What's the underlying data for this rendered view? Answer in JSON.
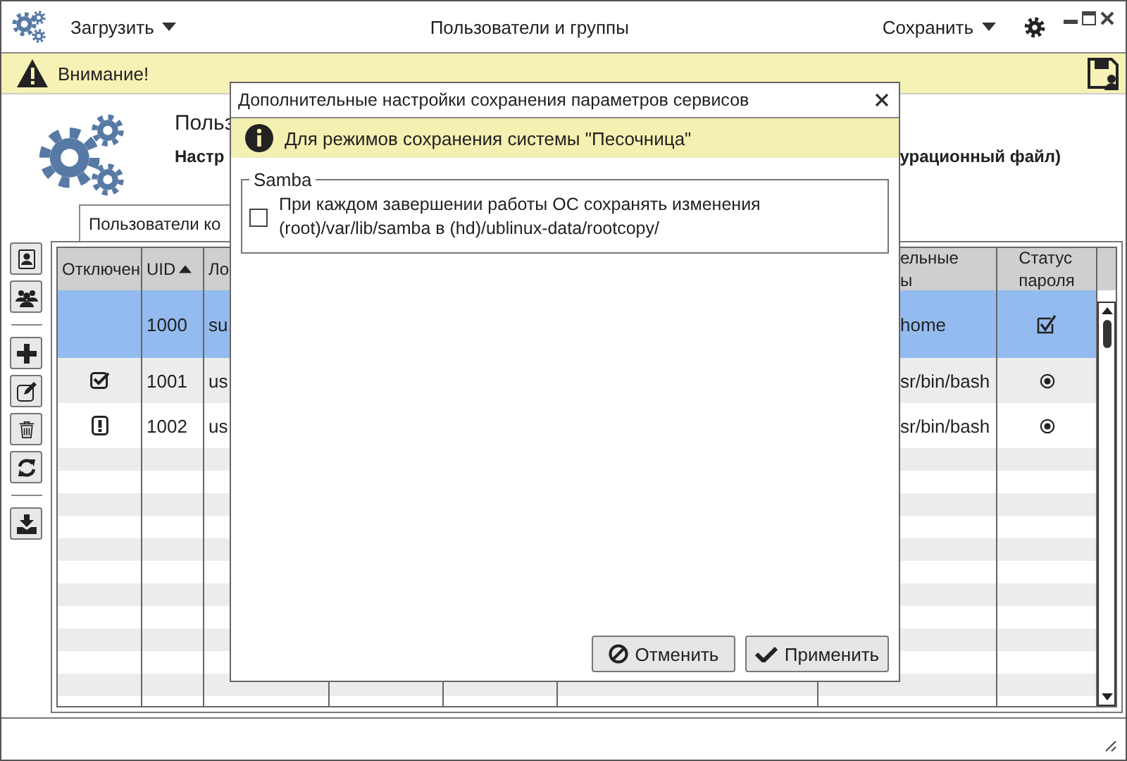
{
  "app": {
    "title": "Пользователи и группы",
    "load_menu": "Загрузить",
    "save_menu": "Сохранить"
  },
  "warning": {
    "text": "Внимание!"
  },
  "header": {
    "title": "Польз",
    "subtitle": "Настр",
    "subtitle_tail": "урационный файл)"
  },
  "tabs": [
    {
      "label": "Пользователи ко",
      "selected": true
    }
  ],
  "table": {
    "columns": [
      {
        "label": "Отключен"
      },
      {
        "label": "UID",
        "sorted": true
      },
      {
        "label": "Ло"
      },
      {
        "label": "ельные\nы"
      },
      {
        "label": "Статус\nпароля"
      }
    ],
    "rows": [
      {
        "selected": true,
        "uid": "1000",
        "login": "su",
        "shell": "home",
        "password": {
          "kind": "check"
        }
      },
      {
        "selected": false,
        "status": {
          "kind": "check"
        },
        "uid": "1001",
        "login": "us",
        "shell": "sr/bin/bash",
        "password": {
          "kind": "dot"
        }
      },
      {
        "selected": false,
        "status": {
          "kind": "alert"
        },
        "uid": "1002",
        "login": "us",
        "shell": "sr/bin/bash",
        "password": {
          "kind": "dot"
        }
      }
    ]
  },
  "dialog": {
    "title": "Дополнительные настройки сохранения параметров сервисов",
    "info": "Для режимов сохранения системы \"Песочница\"",
    "group": {
      "label": "Samba",
      "options": [
        {
          "label": "При каждом завершении работы ОС сохранять изменения\n(root)/var/lib/samba в (hd)/ublinux-data/rootcopy/",
          "checked": false
        }
      ]
    },
    "buttons": [
      {
        "label": "Отменить",
        "kind": "cancel"
      },
      {
        "label": "Применить",
        "kind": "apply"
      }
    ]
  }
}
